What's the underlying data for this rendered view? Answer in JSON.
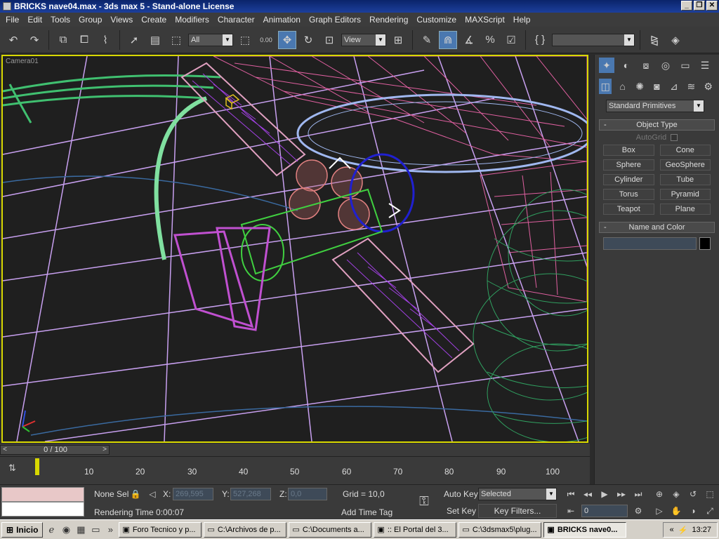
{
  "window": {
    "title": "BRICKS nave04.max - 3ds max 5 - Stand-alone License",
    "min": "_",
    "max": "❐",
    "close": "✕"
  },
  "menu": [
    "File",
    "Edit",
    "Tools",
    "Group",
    "Views",
    "Create",
    "Modifiers",
    "Character",
    "Animation",
    "Graph Editors",
    "Rendering",
    "Customize",
    "MAXScript",
    "Help"
  ],
  "toolbar": {
    "selection_filter": "All",
    "ref_coord": "View",
    "snap_values": "0.00",
    "named_selection": ""
  },
  "viewport": {
    "label": "Camera01"
  },
  "command_panel": {
    "category": "Standard Primitives",
    "object_type_title": "Object Type",
    "autogrid_label": "AutoGrid",
    "primitives": [
      "Box",
      "Cone",
      "Sphere",
      "GeoSphere",
      "Cylinder",
      "Tube",
      "Torus",
      "Pyramid",
      "Teapot",
      "Plane"
    ],
    "name_color_title": "Name and Color"
  },
  "time_slider": {
    "label": "0 / 100",
    "prev": "<",
    "next": ">"
  },
  "track_bar": {
    "labels": [
      "10",
      "20",
      "30",
      "40",
      "50",
      "60",
      "70",
      "80",
      "90",
      "100"
    ]
  },
  "status": {
    "selection": "None Sel",
    "x_label": "X:",
    "x_value": "269,595",
    "y_label": "Y:",
    "y_value": "527,268",
    "z_label": "Z:",
    "z_value": "0,0",
    "grid": "Grid = 10,0",
    "rendering_time": "Rendering Time  0:00:07",
    "add_time_tag": "Add Time Tag",
    "auto_key": "Auto Key",
    "set_key": "Set Key",
    "key_mode": "Selected",
    "key_filters": "Key Filters...",
    "frame": "0"
  },
  "taskbar": {
    "start": "Inicio",
    "tasks": [
      "Foro Tecnico y p...",
      "C:\\Archivos de p...",
      "C:\\Documents a...",
      ":: El Portal del 3...",
      "C:\\3dsmax5\\plug...",
      "BRICKS nave0..."
    ],
    "clock": "13:27"
  },
  "colors": {
    "accent": "#4a78b0",
    "viewport_border": "#d8d800",
    "wire_pink": "#e060a0",
    "wire_green": "#40c070",
    "wire_lavender": "#c8a0f0"
  }
}
